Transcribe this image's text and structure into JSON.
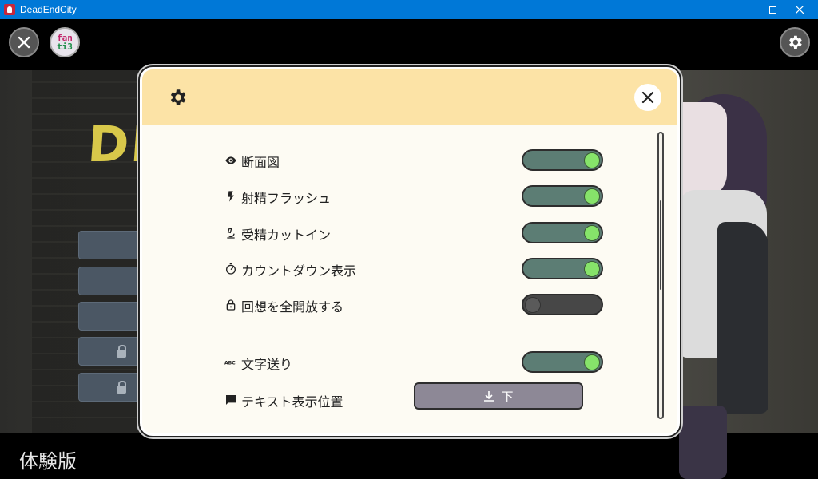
{
  "window": {
    "title": "DeadEndCity",
    "icons": {
      "app": "app-icon",
      "minimize": "minimize-icon",
      "maximize": "maximize-icon",
      "close": "close-icon"
    }
  },
  "game": {
    "background_logo": "DE",
    "fantia_badge": {
      "line1": "fan",
      "line2": "ti3"
    },
    "trial_label": "体験版"
  },
  "dialog": {
    "header_icon": "gear-icon",
    "close_icon": "close-icon",
    "header_color": "#fce3a6",
    "settings": [
      {
        "icon": "eye-icon",
        "label": "断面図",
        "state": "on"
      },
      {
        "icon": "flash-icon",
        "label": "射精フラッシュ",
        "state": "on"
      },
      {
        "icon": "microscope-icon",
        "label": "受精カットイン",
        "state": "on"
      },
      {
        "icon": "timer-icon",
        "label": "カウントダウン表示",
        "state": "on"
      },
      {
        "icon": "lock-open-icon",
        "label": "回想を全開放する",
        "state": "off"
      },
      {
        "icon": "abc-icon",
        "label": "文字送り",
        "state": "on"
      },
      {
        "icon": "chat-icon",
        "label": "テキスト表示位置",
        "control": "button"
      }
    ],
    "text_position": {
      "icon": "download-icon",
      "value": "下"
    },
    "colors": {
      "toggle_on_track": "#5c7d74",
      "toggle_on_knob": "#86e36a",
      "toggle_off_track": "#474747"
    }
  }
}
